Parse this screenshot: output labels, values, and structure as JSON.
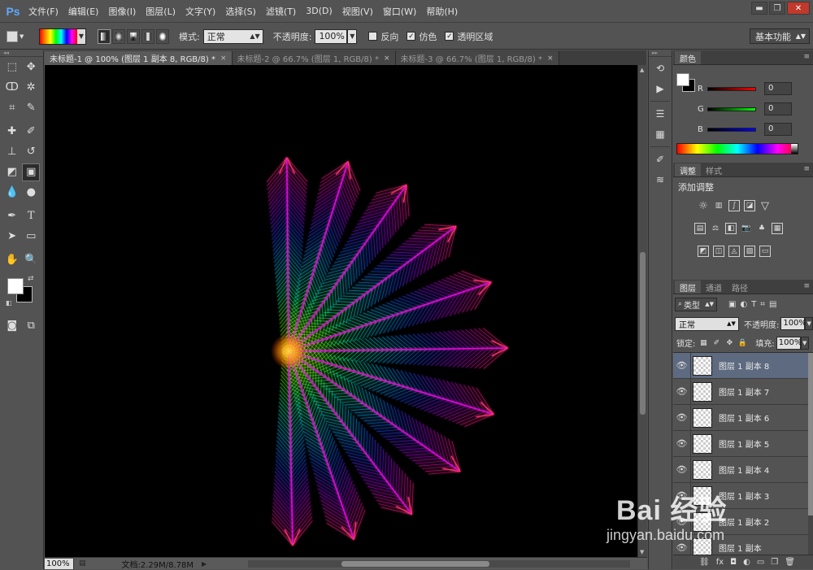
{
  "app": {
    "logo": "Ps"
  },
  "menu": [
    "文件(F)",
    "编辑(E)",
    "图像(I)",
    "图层(L)",
    "文字(Y)",
    "选择(S)",
    "滤镜(T)",
    "3D(D)",
    "视图(V)",
    "窗口(W)",
    "帮助(H)"
  ],
  "window": {
    "minimize": "▬",
    "restore": "❐",
    "close": "✕"
  },
  "options": {
    "mode_label": "模式:",
    "mode_value": "正常",
    "opacity_label": "不透明度:",
    "opacity_value": "100%",
    "reverse_label": "反向",
    "dither_label": "仿色",
    "transparency_label": "透明区域",
    "workspace": "基本功能"
  },
  "doc_tabs": [
    {
      "label": "未标题-1 @ 100% (图层 1 副本 8, RGB/8) *",
      "close": "×"
    },
    {
      "label": "未标题-2 @ 66.7% (图层 1, RGB/8) *",
      "close": "×"
    },
    {
      "label": "未标题-3 @ 66.7% (图层 1, RGB/8) *",
      "close": "×"
    }
  ],
  "status": {
    "zoom": "100%",
    "doc_info": "文档:2.29M/8.78M"
  },
  "color_panel": {
    "tab": "颜色",
    "r_label": "R",
    "r_value": "0",
    "g_label": "G",
    "g_value": "0",
    "b_label": "B",
    "b_value": "0"
  },
  "adjust_panel": {
    "tab1": "调整",
    "tab2": "样式",
    "title": "添加调整"
  },
  "layers_panel": {
    "tab1": "图层",
    "tab2": "通道",
    "tab3": "路径",
    "kind": "类型",
    "blend": "正常",
    "opacity_label": "不透明度:",
    "opacity": "100%",
    "lock_label": "锁定:",
    "fill_label": "填充:",
    "fill": "100%",
    "layers": [
      "图层 1 副本 8",
      "图层 1 副本 7",
      "图层 1 副本 6",
      "图层 1 副本 5",
      "图层 1 副本 4",
      "图层 1 副本 3",
      "图层 1 副本 2",
      "图层 1 副本"
    ]
  },
  "watermark": {
    "main": "Bai 经验",
    "sub": "jingyan.baidu.com"
  },
  "colors": {
    "accent": "#5fa8ff",
    "selected_layer": "#5d6a80",
    "panel_bg": "#535353"
  }
}
